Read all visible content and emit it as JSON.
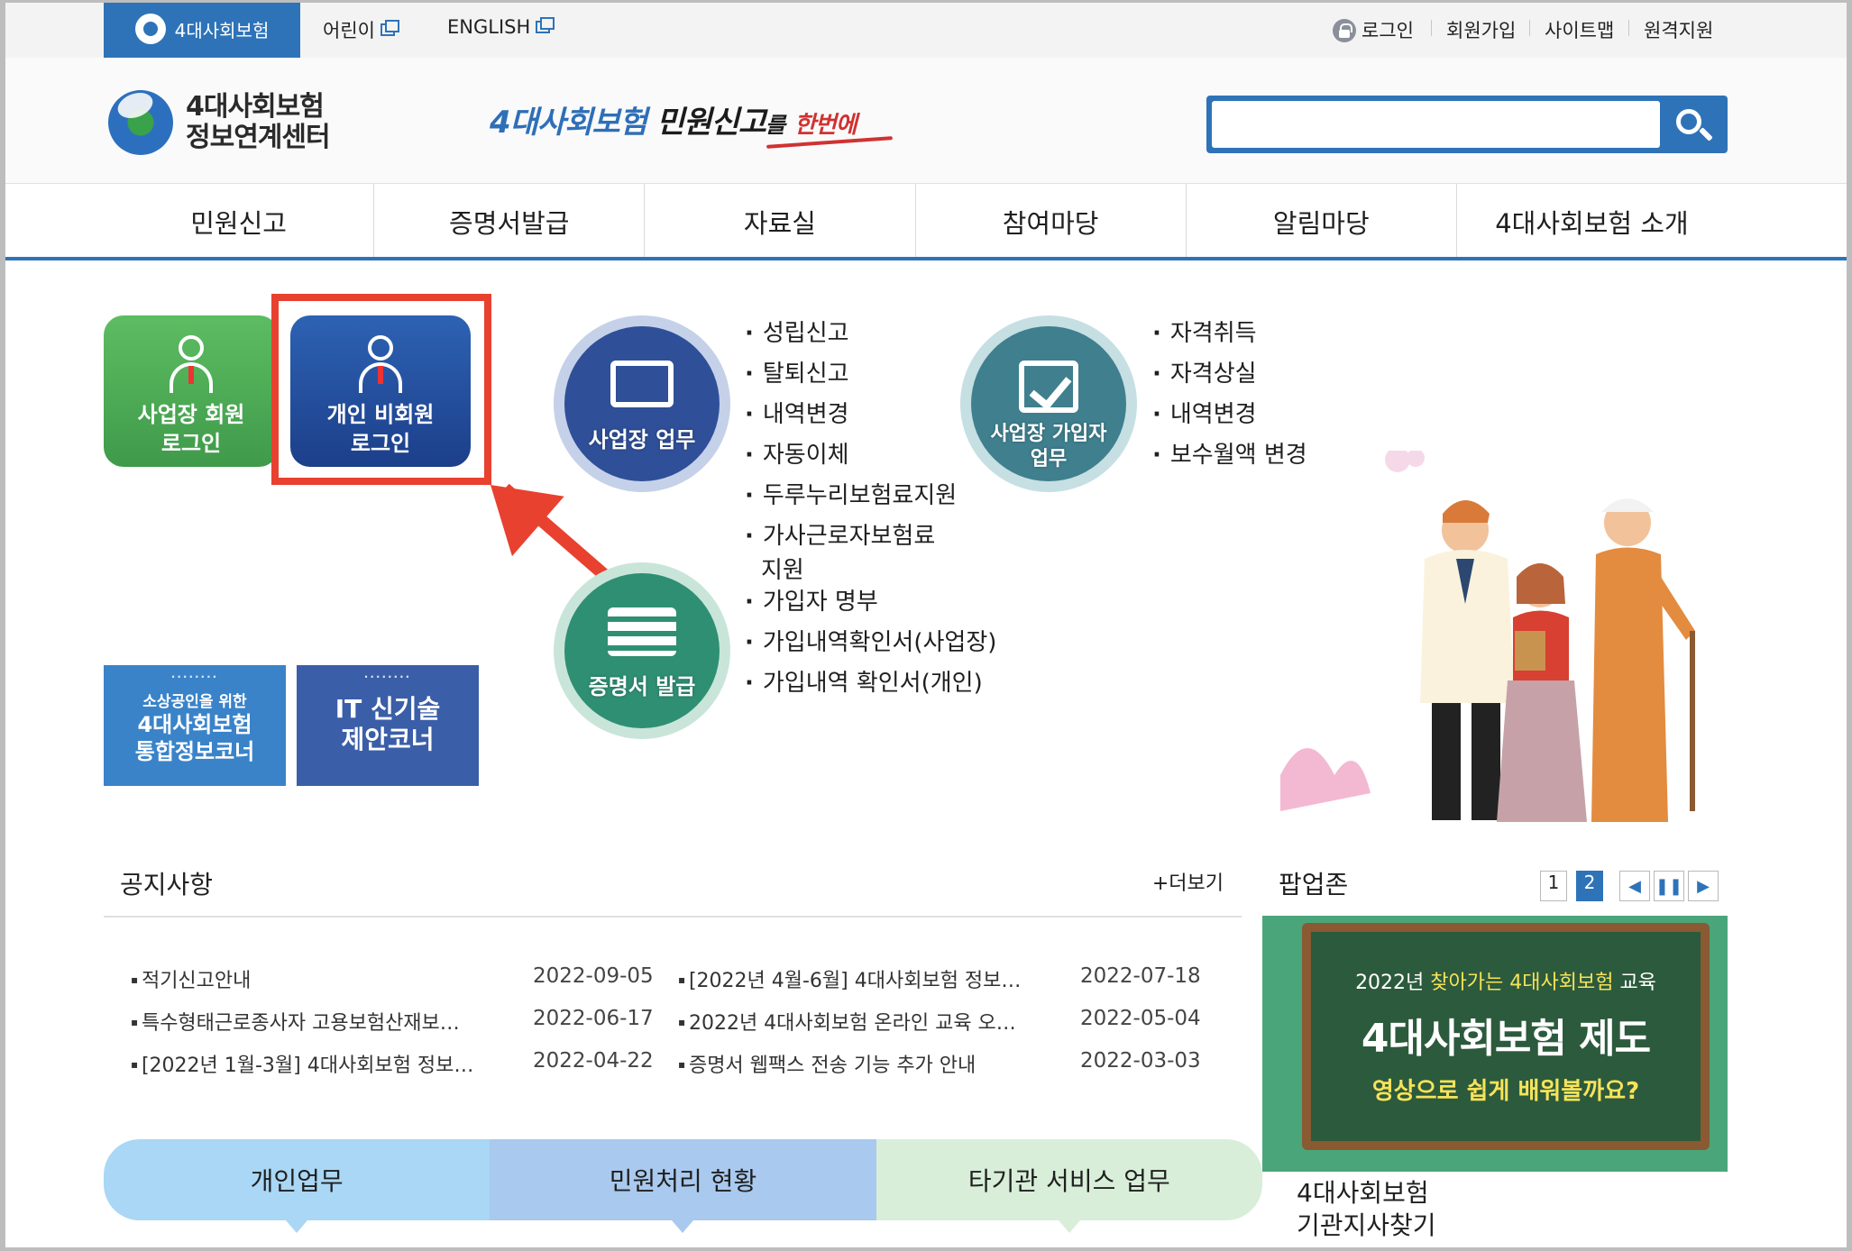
{
  "topbar": {
    "site_tab": "4대사회보험",
    "kids_link": "어린이",
    "english_link": "ENGLISH",
    "login": "로그인",
    "signup": "회원가입",
    "sitemap": "사이트맵",
    "remote": "원격지원"
  },
  "header": {
    "brand_line1": "4대사회보험",
    "brand_line2": "정보연계센터",
    "slogan_blue": "4대사회보험",
    "slogan_black": "민원신고",
    "slogan_small": "를",
    "slogan_red": "한번에",
    "search_placeholder": ""
  },
  "nav": [
    "민원신고",
    "증명서발급",
    "자료실",
    "참여마당",
    "알림마당",
    "4대사회보험 소개"
  ],
  "login_tiles": {
    "business_line1": "사업장 회원",
    "business_line2": "로그인",
    "personal_line1": "개인 비회원",
    "personal_line2": "로그인"
  },
  "banners": {
    "small_biz_line1": "소상공인을 위한",
    "small_biz_line2": "4대사회보험",
    "small_biz_line3": "통합정보코너",
    "it_line1": "IT 신기술",
    "it_line2": "제안코너"
  },
  "badges": {
    "work": "사업장 업무",
    "member_line1": "사업장 가입자",
    "member_line2": "업무",
    "cert": "증명서 발급"
  },
  "work_menu": [
    "성립신고",
    "탈퇴신고",
    "내역변경",
    "자동이체",
    "두루누리보험료지원",
    "가사근로자보험료",
    "지원"
  ],
  "member_menu": [
    "자격취득",
    "자격상실",
    "내역변경",
    "보수월액 변경"
  ],
  "cert_menu": [
    "가입자 명부",
    "가입내역확인서(사업장)",
    "가입내역 확인서(개인)"
  ],
  "notices": {
    "title": "공지사항",
    "more": "+더보기",
    "left": [
      {
        "title": "적기신고안내",
        "date": "2022-09-05"
      },
      {
        "title": "특수형태근로종사자 고용보험산재보…",
        "date": "2022-06-17"
      },
      {
        "title": "[2022년 1월-3월] 4대사회보험 정보…",
        "date": "2022-04-22"
      }
    ],
    "right": [
      {
        "title": "[2022년 4월-6월] 4대사회보험 정보…",
        "date": "2022-07-18"
      },
      {
        "title": "2022년 4대사회보험 온라인 교육 오…",
        "date": "2022-05-04"
      },
      {
        "title": "증명서 웹팩스 전송 기능 추가 안내",
        "date": "2022-03-03"
      }
    ]
  },
  "popup": {
    "title": "팝업존",
    "page1": "1",
    "page2": "2",
    "board_line1_pre": "2022년 ",
    "board_line1_hl": "찾아가는 4대사회보험",
    "board_line1_post": " 교육",
    "board_line2": "4대사회보험 제도",
    "board_line3": "영상으로 쉽게 배워볼까요?",
    "branch_line1": "4대사회보험",
    "branch_line2": "기관지사찾기"
  },
  "bottom_tabs": [
    "개인업무",
    "민원처리 현황",
    "타기관 서비스 업무"
  ],
  "colors": {
    "brand_blue": "#2e73b8",
    "highlight_red": "#e8412f"
  }
}
